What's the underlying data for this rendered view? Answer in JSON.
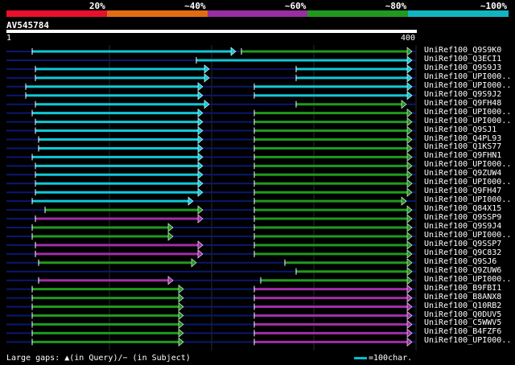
{
  "query_name": "AV545784",
  "ruler": {
    "start": "1",
    "end": "400"
  },
  "identity_legend": [
    {
      "label": "",
      "color": "#e8102a"
    },
    {
      "label": "20%",
      "color": "#e06d14"
    },
    {
      "label": "~40%",
      "color": "#982ea0"
    },
    {
      "label": "~60%",
      "color": "#1f9a1f"
    },
    {
      "label": "~80%",
      "color": "#10b5c0"
    },
    {
      "label": "~100%",
      "color": ""
    }
  ],
  "colors": {
    "cyan": "#10c8d8",
    "green": "#1f9a1f",
    "magenta": "#a02ea8",
    "connector": "#0a1870",
    "grid": "#2a2a2a"
  },
  "rows": [
    {
      "label": "UniRef100_Q9S9K0",
      "segs": [
        [
          "cyan",
          40,
          293
        ],
        [
          "green",
          300,
          512
        ]
      ]
    },
    {
      "label": "UniRef100_Q3ECI1",
      "segs": [
        [
          "cyan",
          244,
          512
        ]
      ]
    },
    {
      "label": "UniRef100_Q9S9J3",
      "segs": [
        [
          "cyan",
          44,
          260
        ],
        [
          "cyan",
          368,
          512
        ]
      ]
    },
    {
      "label": "UniRef100_UPI000..",
      "segs": [
        [
          "cyan",
          44,
          260
        ],
        [
          "cyan",
          368,
          512
        ]
      ]
    },
    {
      "label": "UniRef100_UPI000..",
      "segs": [
        [
          "cyan",
          32,
          252
        ],
        [
          "cyan",
          316,
          512
        ]
      ]
    },
    {
      "label": "UniRef100_Q9S9J2",
      "segs": [
        [
          "cyan",
          32,
          252
        ],
        [
          "cyan",
          316,
          512
        ]
      ]
    },
    {
      "label": "UniRef100_Q9FH48",
      "segs": [
        [
          "cyan",
          44,
          260
        ],
        [
          "green",
          368,
          505
        ]
      ]
    },
    {
      "label": "UniRef100_UPI000..",
      "segs": [
        [
          "cyan",
          40,
          252
        ],
        [
          "green",
          316,
          512
        ]
      ]
    },
    {
      "label": "UniRef100_UPI000..",
      "segs": [
        [
          "cyan",
          44,
          252
        ],
        [
          "green",
          316,
          512
        ]
      ]
    },
    {
      "label": "UniRef100_Q9SJ1",
      "segs": [
        [
          "cyan",
          44,
          252
        ],
        [
          "green",
          316,
          512
        ]
      ]
    },
    {
      "label": "UniRef100_Q4PL93",
      "segs": [
        [
          "cyan",
          48,
          252
        ],
        [
          "green",
          316,
          512
        ]
      ]
    },
    {
      "label": "UniRef100_Q1KS77",
      "segs": [
        [
          "cyan",
          48,
          252
        ],
        [
          "green",
          316,
          512
        ]
      ]
    },
    {
      "label": "UniRef100_Q9FHN1",
      "segs": [
        [
          "cyan",
          40,
          252
        ],
        [
          "green",
          316,
          512
        ]
      ]
    },
    {
      "label": "UniRef100_UPI000..",
      "segs": [
        [
          "cyan",
          44,
          252
        ],
        [
          "green",
          316,
          512
        ]
      ]
    },
    {
      "label": "UniRef100_Q9ZUW4",
      "segs": [
        [
          "cyan",
          44,
          252
        ],
        [
          "green",
          316,
          512
        ]
      ]
    },
    {
      "label": "UniRef100_UPI000..",
      "segs": [
        [
          "cyan",
          44,
          252
        ],
        [
          "green",
          316,
          512
        ]
      ]
    },
    {
      "label": "UniRef100_Q9FH47",
      "segs": [
        [
          "cyan",
          44,
          252
        ],
        [
          "green",
          316,
          512
        ]
      ]
    },
    {
      "label": "UniRef100_UPI000..",
      "segs": [
        [
          "cyan",
          40,
          240
        ],
        [
          "green",
          316,
          505
        ]
      ]
    },
    {
      "label": "UniRef100_Q84X15",
      "segs": [
        [
          "green",
          56,
          252
        ],
        [
          "green",
          316,
          512
        ]
      ]
    },
    {
      "label": "UniRef100_Q9SSP9",
      "segs": [
        [
          "magenta",
          44,
          252
        ],
        [
          "green",
          316,
          512
        ]
      ]
    },
    {
      "label": "UniRef100_Q9S9J4",
      "segs": [
        [
          "green",
          40,
          215
        ],
        [
          "green",
          316,
          512
        ]
      ]
    },
    {
      "label": "UniRef100_UPI000..",
      "segs": [
        [
          "green",
          40,
          215
        ],
        [
          "green",
          316,
          512
        ]
      ]
    },
    {
      "label": "UniRef100_Q9SSP7",
      "segs": [
        [
          "magenta",
          44,
          252
        ],
        [
          "green",
          316,
          512
        ]
      ]
    },
    {
      "label": "UniRef100_Q9C832",
      "segs": [
        [
          "magenta",
          44,
          252
        ],
        [
          "green",
          316,
          512
        ]
      ]
    },
    {
      "label": "UniRef100_Q9SJ6",
      "segs": [
        [
          "green",
          48,
          244
        ],
        [
          "green",
          354,
          512
        ]
      ]
    },
    {
      "label": "UniRef100_Q9ZUW6",
      "segs": [
        [
          "green",
          368,
          512
        ]
      ]
    },
    {
      "label": "UniRef100_UPI000..",
      "segs": [
        [
          "magenta",
          48,
          215
        ],
        [
          "green",
          324,
          512
        ]
      ]
    },
    {
      "label": "UniRef100_B9FBI1",
      "segs": [
        [
          "green",
          40,
          228
        ],
        [
          "magenta",
          316,
          512
        ]
      ]
    },
    {
      "label": "UniRef100_B8ANX8",
      "segs": [
        [
          "green",
          40,
          228
        ],
        [
          "magenta",
          316,
          512
        ]
      ]
    },
    {
      "label": "UniRef100_Q10RB2",
      "segs": [
        [
          "green",
          40,
          228
        ],
        [
          "magenta",
          316,
          512
        ]
      ]
    },
    {
      "label": "UniRef100_Q0DUV5",
      "segs": [
        [
          "green",
          40,
          228
        ],
        [
          "magenta",
          316,
          512
        ]
      ]
    },
    {
      "label": "UniRef100_C5WWV5",
      "segs": [
        [
          "green",
          40,
          228
        ],
        [
          "magenta",
          316,
          512
        ]
      ]
    },
    {
      "label": "UniRef100_B4FZF6",
      "segs": [
        [
          "green",
          40,
          228
        ],
        [
          "magenta",
          316,
          512
        ]
      ]
    },
    {
      "label": "UniRef100_UPI000..",
      "segs": [
        [
          "green",
          40,
          228
        ],
        [
          "magenta",
          316,
          512
        ]
      ]
    }
  ],
  "footer": {
    "gaps_text": "Large gaps: ▲(in Query)/− (in Subject)",
    "scale_text": "=100char."
  }
}
